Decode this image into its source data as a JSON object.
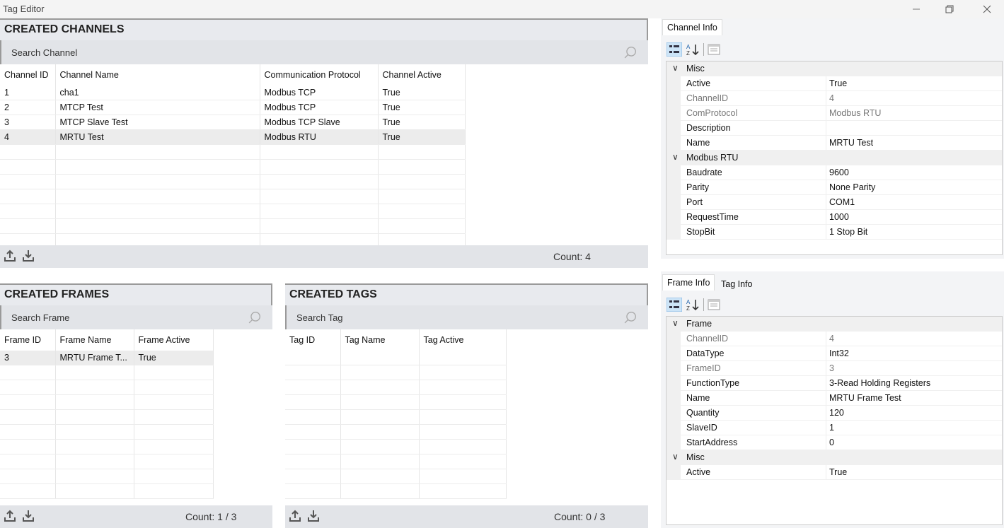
{
  "window": {
    "title": "Tag Editor"
  },
  "channels": {
    "header": "CREATED CHANNELS",
    "search_placeholder": "Search Channel",
    "columns": [
      "Channel ID",
      "Channel Name",
      "Communication Protocol",
      "Channel Active"
    ],
    "rows": [
      [
        "1",
        "cha1",
        "Modbus TCP",
        "True"
      ],
      [
        "2",
        "MTCP Test",
        "Modbus TCP",
        "True"
      ],
      [
        "3",
        "MTCP Slave Test",
        "Modbus TCP Slave",
        "True"
      ],
      [
        "4",
        "MRTU Test",
        "Modbus RTU",
        "True"
      ]
    ],
    "selected_row": 3,
    "count": "Count: 4"
  },
  "frames": {
    "header": "CREATED FRAMES",
    "search_placeholder": "Search Frame",
    "columns": [
      "Frame ID",
      "Frame Name",
      "Frame Active"
    ],
    "rows": [
      [
        "3",
        "MRTU Frame T...",
        "True"
      ]
    ],
    "count": "Count: 1 / 3"
  },
  "tags": {
    "header": "CREATED TAGS",
    "search_placeholder": "Search Tag",
    "columns": [
      "Tag ID",
      "Tag Name",
      "Tag Active"
    ],
    "rows": [],
    "count": "Count: 0 / 3"
  },
  "channel_info": {
    "tab": "Channel Info",
    "rows": [
      {
        "type": "cat",
        "k": "Misc"
      },
      {
        "k": "Active",
        "v": "True"
      },
      {
        "k": "ChannelID",
        "v": "4",
        "ro": true
      },
      {
        "k": "ComProtocol",
        "v": "Modbus RTU",
        "ro": true
      },
      {
        "k": "Description",
        "v": ""
      },
      {
        "k": "Name",
        "v": "MRTU Test"
      },
      {
        "type": "cat",
        "k": "Modbus RTU"
      },
      {
        "k": "Baudrate",
        "v": "9600"
      },
      {
        "k": "Parity",
        "v": "None Parity"
      },
      {
        "k": "Port",
        "v": "COM1"
      },
      {
        "k": "RequestTime",
        "v": "1000"
      },
      {
        "k": "StopBit",
        "v": "1 Stop Bit"
      }
    ]
  },
  "frame_info": {
    "tabs": [
      "Frame Info",
      "Tag Info"
    ],
    "rows": [
      {
        "type": "cat",
        "k": "Frame"
      },
      {
        "k": "ChannelID",
        "v": "4",
        "ro": true
      },
      {
        "k": "DataType",
        "v": "Int32"
      },
      {
        "k": "FrameID",
        "v": "3",
        "ro": true
      },
      {
        "k": "FunctionType",
        "v": "3-Read Holding Registers"
      },
      {
        "k": "Name",
        "v": "MRTU Frame Test"
      },
      {
        "k": "Quantity",
        "v": "120"
      },
      {
        "k": "SlaveID",
        "v": "1"
      },
      {
        "k": "StartAddress",
        "v": "0"
      },
      {
        "type": "cat",
        "k": "Misc"
      },
      {
        "k": "Active",
        "v": "True"
      }
    ]
  },
  "icons": [
    "minimize-icon",
    "restore-icon",
    "close-icon",
    "search-icon",
    "upload-icon",
    "download-icon",
    "categorized-icon",
    "alphabetical-icon",
    "property-pages-icon",
    "chevron-down-icon"
  ]
}
